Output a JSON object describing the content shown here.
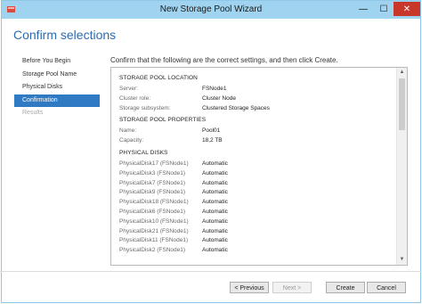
{
  "window": {
    "title": "New Storage Pool Wizard",
    "controls": {
      "minimize": "—",
      "maximize": "☐",
      "close": "✕"
    }
  },
  "page_title": "Confirm selections",
  "nav": [
    {
      "label": "Before You Begin",
      "state": "normal"
    },
    {
      "label": "Storage Pool Name",
      "state": "normal"
    },
    {
      "label": "Physical Disks",
      "state": "normal"
    },
    {
      "label": "Confirmation",
      "state": "active"
    },
    {
      "label": "Results",
      "state": "disabled"
    }
  ],
  "instruction": "Confirm that the following are the correct settings, and then click Create.",
  "location": {
    "title": "STORAGE POOL LOCATION",
    "rows": [
      {
        "key": "Server:",
        "value": "FSNode1"
      },
      {
        "key": "Cluster role:",
        "value": "Cluster Node"
      },
      {
        "key": "Storage subsystem:",
        "value": "Clustered Storage Spaces"
      }
    ]
  },
  "properties": {
    "title": "STORAGE POOL PROPERTIES",
    "rows": [
      {
        "key": "Name:",
        "value": "Pool01"
      },
      {
        "key": "Capacity:",
        "value": "18,2 TB"
      }
    ]
  },
  "disks": {
    "title": "PHYSICAL DISKS",
    "rows": [
      {
        "key": "PhysicalDisk17 (FSNode1)",
        "value": "Automatic"
      },
      {
        "key": "PhysicalDisk3 (FSNode1)",
        "value": "Automatic"
      },
      {
        "key": "PhysicalDisk7 (FSNode1)",
        "value": "Automatic"
      },
      {
        "key": "PhysicalDisk9 (FSNode1)",
        "value": "Automatic"
      },
      {
        "key": "PhysicalDisk18 (FSNode1)",
        "value": "Automatic"
      },
      {
        "key": "PhysicalDisk6 (FSNode1)",
        "value": "Automatic"
      },
      {
        "key": "PhysicalDisk10 (FSNode1)",
        "value": "Automatic"
      },
      {
        "key": "PhysicalDisk21 (FSNode1)",
        "value": "Automatic"
      },
      {
        "key": "PhysicalDisk11 (FSNode1)",
        "value": "Automatic"
      },
      {
        "key": "PhysicalDisk2 (FSNode1)",
        "value": "Automatic"
      }
    ]
  },
  "buttons": {
    "previous": "< Previous",
    "next": "Next >",
    "create": "Create",
    "cancel": "Cancel"
  },
  "colors": {
    "titlebar": "#9fd3ef",
    "accent": "#2f7ac2",
    "close": "#c7382b"
  },
  "icons": {
    "app": "storage-pool-wizard-icon"
  }
}
